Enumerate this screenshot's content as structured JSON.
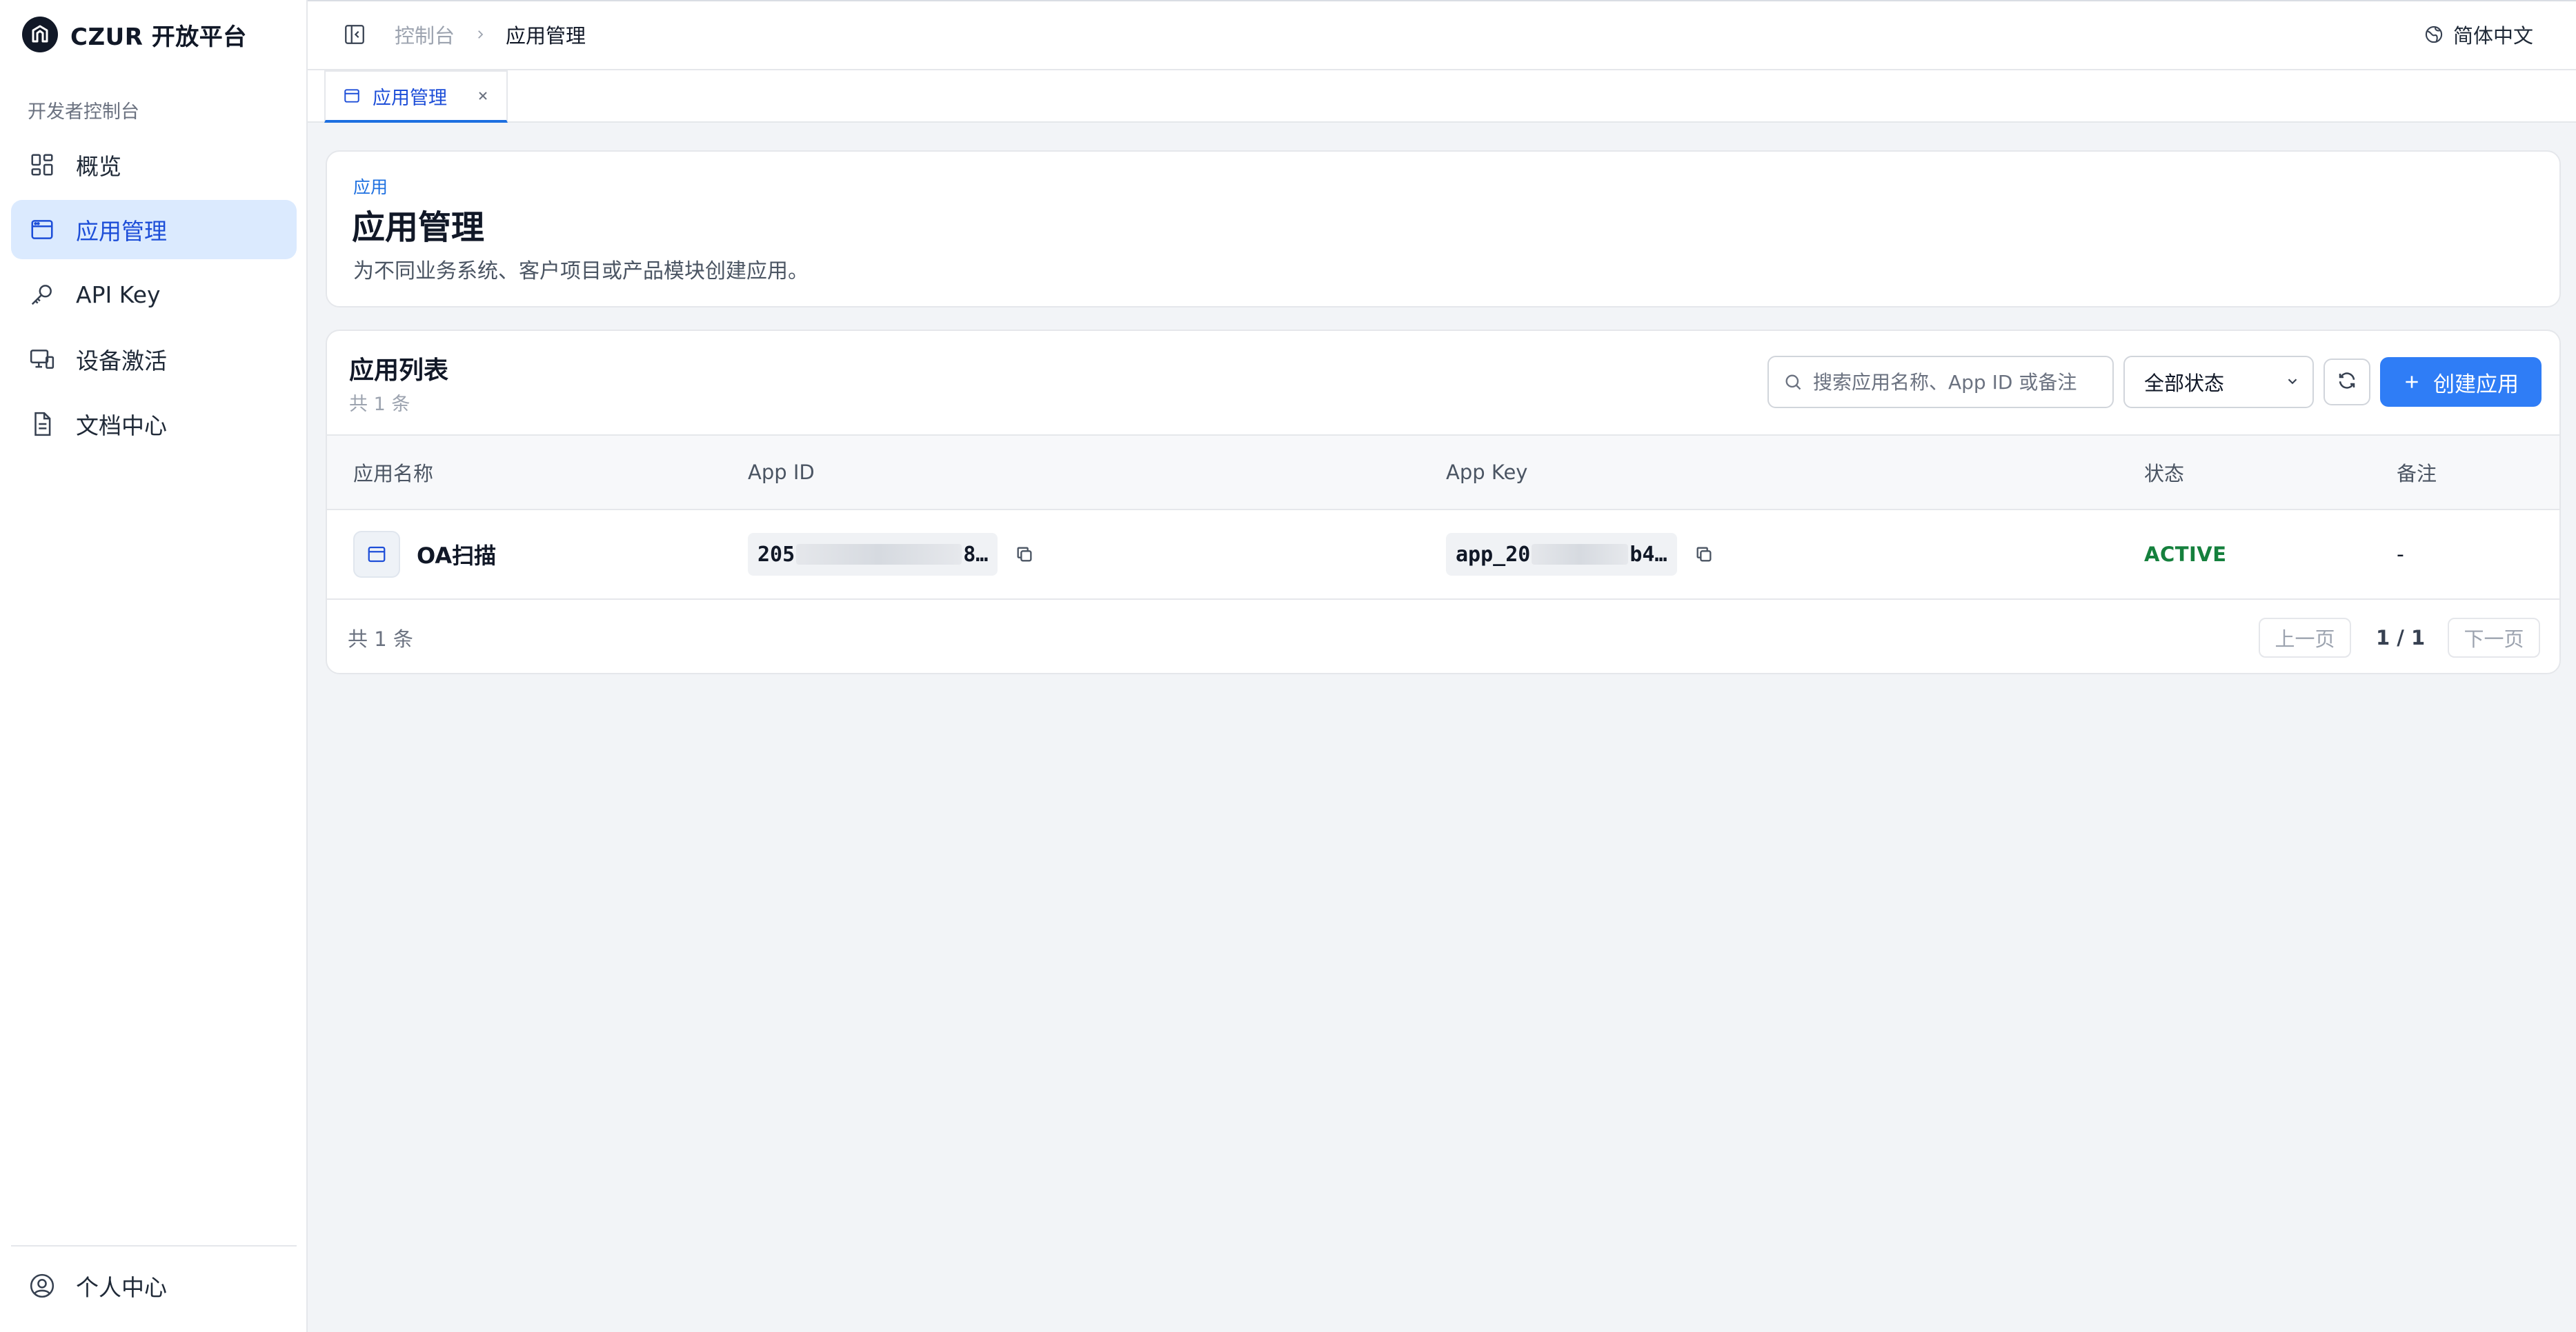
{
  "brand": {
    "name": "CZUR 开放平台"
  },
  "sidebar": {
    "section_label": "开发者控制台",
    "items": [
      {
        "label": "概览",
        "icon": "dashboard-icon"
      },
      {
        "label": "应用管理",
        "icon": "app-window-icon",
        "active": true
      },
      {
        "label": "API Key",
        "icon": "key-icon"
      },
      {
        "label": "设备激活",
        "icon": "device-icon"
      },
      {
        "label": "文档中心",
        "icon": "document-icon"
      }
    ],
    "profile_label": "个人中心"
  },
  "header": {
    "breadcrumb": [
      "控制台",
      "应用管理"
    ],
    "language": "简体中文"
  },
  "tabs": [
    {
      "label": "应用管理",
      "active": true
    }
  ],
  "intro": {
    "eyebrow": "应用",
    "title": "应用管理",
    "description": "为不同业务系统、客户项目或产品模块创建应用。"
  },
  "list": {
    "title": "应用列表",
    "count": "共 1 条",
    "search_placeholder": "搜索应用名称、App ID 或备注",
    "status_filter": "全部状态",
    "create_label": "创建应用",
    "columns": [
      "应用名称",
      "App ID",
      "App Key",
      "状态",
      "备注"
    ],
    "rows": [
      {
        "name": "OA扫描",
        "app_id_prefix": "205",
        "app_id_suffix": "8…",
        "app_key_prefix": "app_20",
        "app_key_suffix": "b4…",
        "status": "ACTIVE",
        "remark": "-"
      }
    ],
    "footer_count": "共 1 条",
    "prev_label": "上一页",
    "page_indicator": "1 / 1",
    "next_label": "下一页"
  },
  "colors": {
    "primary": "#2f7df6",
    "active_nav_bg": "#dbeafe",
    "status_active": "#15803d"
  }
}
